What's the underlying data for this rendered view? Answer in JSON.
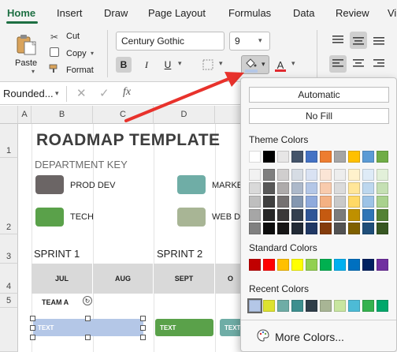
{
  "ribbon": {
    "tabs": [
      "Home",
      "Insert",
      "Draw",
      "Page Layout",
      "Formulas",
      "Data",
      "Review",
      "Vi"
    ],
    "paste_label": "Paste",
    "cut_label": "Cut",
    "copy_label": "Copy",
    "format_label": "Format",
    "font_name": "Century Gothic",
    "font_size": "9",
    "bold_label": "B",
    "italic_label": "I",
    "underline_label": "U",
    "font_color_glyph": "A",
    "fill_color_hex": "#b4c7e7",
    "font_color_hex": "#e0292f"
  },
  "formula_bar": {
    "name_box": "Rounded...",
    "fx_label": "fx"
  },
  "grid": {
    "columns": [
      "A",
      "B",
      "C",
      "D"
    ],
    "rows": [
      "1",
      "2",
      "3",
      "4",
      "5"
    ],
    "title": "ROADMAP TEMPLATE",
    "department_key_label": "DEPARTMENT KEY",
    "departments": [
      {
        "label": "PROD DEV",
        "color": "#6b6565"
      },
      {
        "label": "TECH",
        "color": "#5aa14a"
      },
      {
        "label": "MARKE",
        "color": "#6fada6"
      },
      {
        "label": "WEB DI",
        "color": "#a8b595"
      }
    ],
    "sprints": [
      "SPRINT 1",
      "SPRINT 2"
    ],
    "months": [
      "JUL",
      "AUG",
      "SEPT",
      "O"
    ],
    "team_label": "TEAM A",
    "bars": [
      {
        "label": "TEXT",
        "color": "#b4c7e7"
      },
      {
        "label": "TEXT",
        "color": "#5aa14a"
      },
      {
        "label": "TEXT",
        "color": "#6fada6"
      }
    ]
  },
  "color_picker": {
    "automatic_label": "Automatic",
    "no_fill_label": "No Fill",
    "theme_colors_label": "Theme Colors",
    "standard_colors_label": "Standard Colors",
    "recent_colors_label": "Recent Colors",
    "more_colors_label": "More Colors...",
    "theme_columns": [
      [
        "#ffffff",
        "#f2f2f2",
        "#d9d9d9",
        "#bfbfbf",
        "#a6a6a6",
        "#808080"
      ],
      [
        "#000000",
        "#7f7f7f",
        "#595959",
        "#404040",
        "#262626",
        "#0d0d0d"
      ],
      [
        "#e7e6e6",
        "#d0cece",
        "#aeabab",
        "#757171",
        "#3a3838",
        "#171616"
      ],
      [
        "#44546a",
        "#d6dce4",
        "#adb9ca",
        "#8497b0",
        "#333f4f",
        "#222a35"
      ],
      [
        "#4472c4",
        "#d9e2f3",
        "#b4c7e7",
        "#8faadc",
        "#2f5597",
        "#203864"
      ],
      [
        "#ed7d31",
        "#fbe5d6",
        "#f8cbad",
        "#f4b183",
        "#c55a11",
        "#843c0c"
      ],
      [
        "#a5a5a5",
        "#ededed",
        "#dbdbdb",
        "#c9c9c9",
        "#7b7b7b",
        "#525252"
      ],
      [
        "#ffc000",
        "#fff2cc",
        "#ffe699",
        "#ffd966",
        "#bf9000",
        "#7f6000"
      ],
      [
        "#5b9bd5",
        "#deebf7",
        "#bdd7ee",
        "#9dc3e6",
        "#2e75b6",
        "#1f4e79"
      ],
      [
        "#70ad47",
        "#e2f0d9",
        "#c5e0b4",
        "#a9d18e",
        "#548235",
        "#385723"
      ]
    ],
    "standard_colors": [
      "#c00000",
      "#ff0000",
      "#ffc000",
      "#ffff00",
      "#92d050",
      "#00b050",
      "#00b0f0",
      "#0070c0",
      "#002060",
      "#7030a0"
    ],
    "recent_colors": [
      "#b4c7e7",
      "#dde22f",
      "#6fada6",
      "#3d8f8f",
      "#2f3e4a",
      "#a8b595",
      "#c8e6a0",
      "#4dbbd6",
      "#35b24f",
      "#00a86b"
    ]
  }
}
